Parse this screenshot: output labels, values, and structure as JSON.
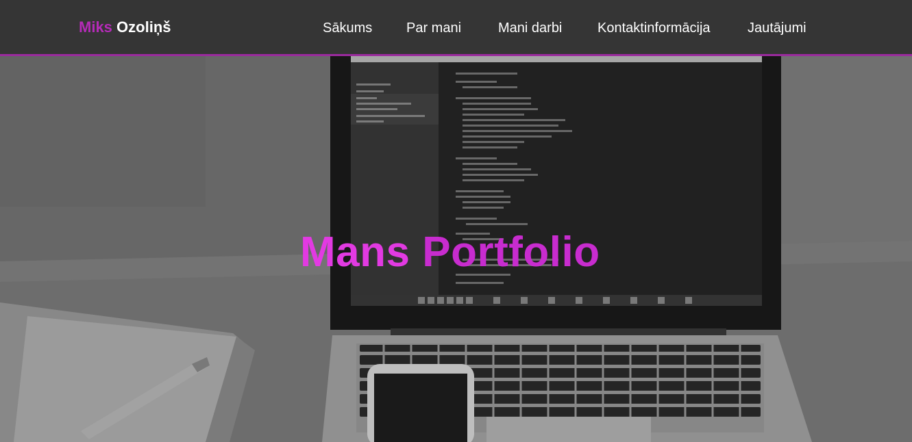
{
  "brand": {
    "first": "Miks",
    "last": "Ozoliņš"
  },
  "nav": {
    "items": [
      {
        "id": "sakums",
        "label": "Sākums"
      },
      {
        "id": "par-mani",
        "label": "Par mani"
      },
      {
        "id": "mani-darbi",
        "label": "Mani darbi"
      },
      {
        "id": "kontakti",
        "label": "Kontaktinformācija"
      },
      {
        "id": "jautajumi",
        "label": "Jautājumi"
      }
    ]
  },
  "hero": {
    "title_part1": "Mans",
    "title_part2": "Portfolio",
    "background_icon": "laptop-desk-photo"
  },
  "colors": {
    "header_bg": "#353535",
    "accent": "#9b2a9e",
    "brand_first": "#b52bb8",
    "title_part1": "#e23ae2",
    "title_part2": "#c82ccf"
  }
}
